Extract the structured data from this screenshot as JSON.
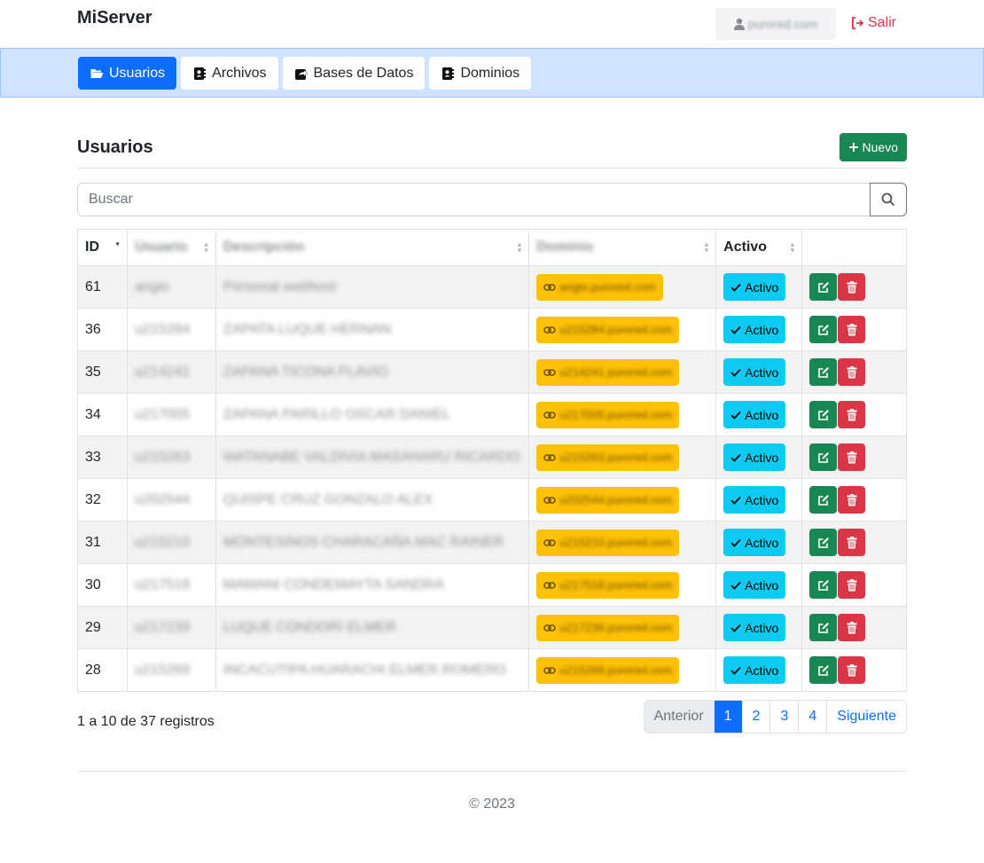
{
  "header": {
    "brand": "MiServer",
    "user": "purored.com",
    "logout_label": "Salir"
  },
  "nav": {
    "tabs": [
      {
        "label": "Usuarios",
        "active": true
      },
      {
        "label": "Archivos",
        "active": false
      },
      {
        "label": "Bases de Datos",
        "active": false
      },
      {
        "label": "Dominios",
        "active": false
      }
    ]
  },
  "main": {
    "title": "Usuarios",
    "new_label": "Nuevo",
    "search_placeholder": "Buscar"
  },
  "table": {
    "columns": [
      "ID",
      "Usuario",
      "Descripción",
      "Dominio",
      "Activo",
      ""
    ],
    "rows": [
      {
        "id": "61",
        "usuario": "angio",
        "descripcion": "Personal webhost",
        "dominio": "angio.purored.com",
        "activo": "Activo"
      },
      {
        "id": "36",
        "usuario": "u215284",
        "descripcion": "ZAPATA LUQUE HERNAN",
        "dominio": "u215284.purored.com",
        "activo": "Activo"
      },
      {
        "id": "35",
        "usuario": "u214241",
        "descripcion": "ZAPANA TICONA FLAVIO",
        "dominio": "u214241.purored.com",
        "activo": "Activo"
      },
      {
        "id": "34",
        "usuario": "u217005",
        "descripcion": "ZAPANA PARILLO OSCAR DANIEL",
        "dominio": "u217005.purored.com",
        "activo": "Activo"
      },
      {
        "id": "33",
        "usuario": "u215263",
        "descripcion": "WATANABE VALDIVIA MASAHARU RICARDO",
        "dominio": "u215263.purored.com",
        "activo": "Activo"
      },
      {
        "id": "32",
        "usuario": "u202544",
        "descripcion": "QUISPE CRUZ GONZALO ALEX",
        "dominio": "u202544.purored.com",
        "activo": "Activo"
      },
      {
        "id": "31",
        "usuario": "u215210",
        "descripcion": "MONTESINOS CHARACAÑA MAC RAINER",
        "dominio": "u215210.purored.com",
        "activo": "Activo"
      },
      {
        "id": "30",
        "usuario": "u217518",
        "descripcion": "MAMANI CONDEMAYTA SANDRA",
        "dominio": "u217518.purored.com",
        "activo": "Activo"
      },
      {
        "id": "29",
        "usuario": "u217239",
        "descripcion": "LUQUE CONDORI ELMER",
        "dominio": "u217239.purored.com",
        "activo": "Activo"
      },
      {
        "id": "28",
        "usuario": "u215269",
        "descripcion": "INCACUTIPA HUARACHI ELMER ROMERO",
        "dominio": "u215269.purored.com",
        "activo": "Activo"
      }
    ]
  },
  "pagination": {
    "info": "1 a 10 de 37 registros",
    "prev": "Anterior",
    "next": "Siguiente",
    "pages": [
      "1",
      "2",
      "3",
      "4"
    ],
    "current": "1"
  },
  "footer": {
    "text": "© 2023"
  },
  "colors": {
    "primary": "#0d6efd",
    "success": "#198754",
    "danger": "#dc3545",
    "info": "#0dcaf0",
    "warning": "#ffc107",
    "nav_bg": "#cfe2ff"
  }
}
